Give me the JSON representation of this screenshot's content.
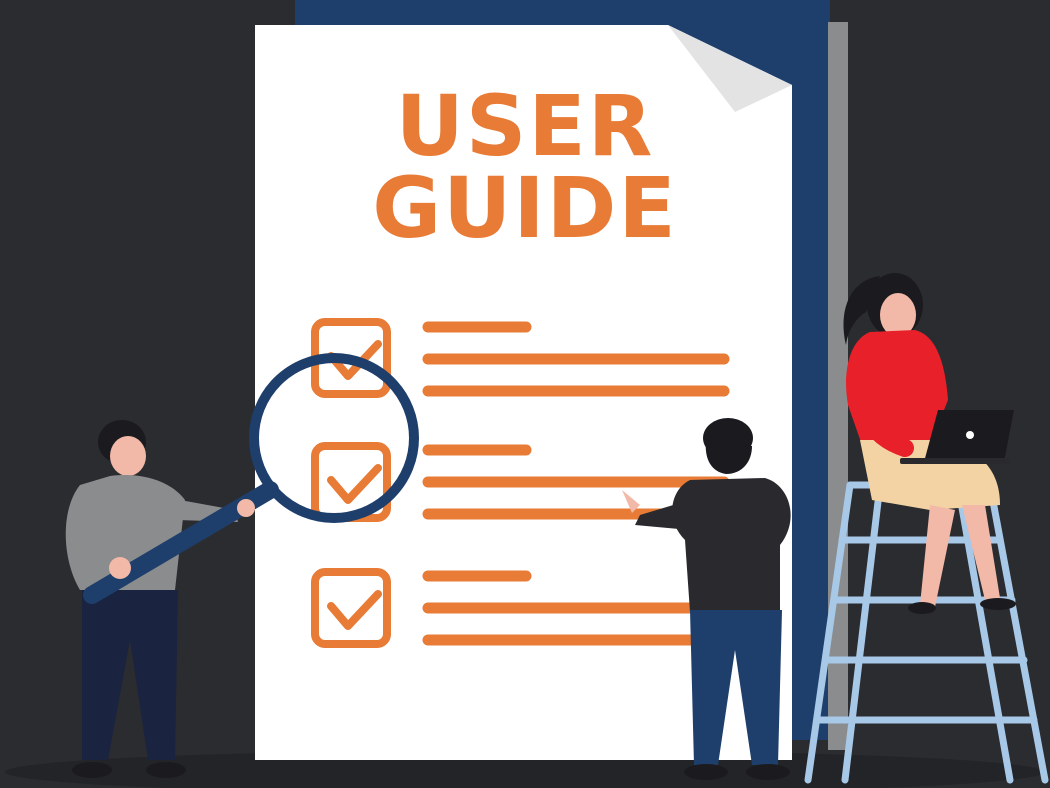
{
  "document": {
    "title_line1": "USER",
    "title_line2": "GUIDE",
    "checklist": [
      {
        "checked": true
      },
      {
        "checked": true
      },
      {
        "checked": true
      }
    ]
  },
  "colors": {
    "background": "#2b2c30",
    "accent": "#e87b35",
    "paper": "#ffffff",
    "folder": "#1e3f6b"
  },
  "icons": [
    "magnifier-icon",
    "checkmark-icon",
    "laptop-icon",
    "ladder-icon"
  ]
}
